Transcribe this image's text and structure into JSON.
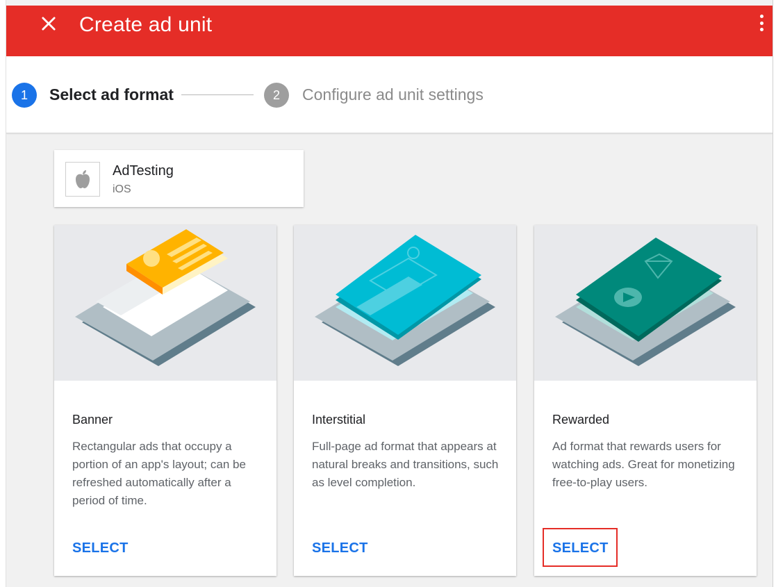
{
  "appbar": {
    "title": "Create ad unit",
    "background": "#e52d27",
    "close_icon": "close-icon",
    "menu_icon": "more-vert-icon"
  },
  "stepper": {
    "steps": [
      {
        "number": "1",
        "label": "Select ad format",
        "state": "active"
      },
      {
        "number": "2",
        "label": "Configure ad unit settings",
        "state": "inactive"
      }
    ],
    "active_color": "#1a73e8",
    "inactive_color": "#9e9e9e"
  },
  "app": {
    "name": "AdTesting",
    "platform": "iOS",
    "icon": "apple-icon"
  },
  "formats": [
    {
      "title": "Banner",
      "description": "Rectangular ads that occupy a portion of an app's layout; can be refreshed automatically after a period of time.",
      "action": "SELECT",
      "illustration": "banner-illustration"
    },
    {
      "title": "Interstitial",
      "description": "Full-page ad format that appears at natural breaks and transitions, such as level completion.",
      "action": "SELECT",
      "illustration": "interstitial-illustration"
    },
    {
      "title": "Rewarded",
      "description": "Ad format that rewards users for watching ads. Great for monetizing free-to-play users.",
      "action": "SELECT",
      "illustration": "rewarded-illustration",
      "highlighted": true
    }
  ],
  "colors": {
    "link": "#1a73e8",
    "highlight_box": "#e52d27"
  }
}
